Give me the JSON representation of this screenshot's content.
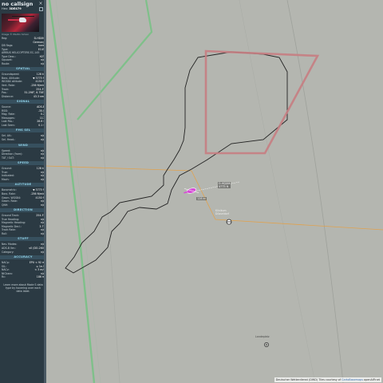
{
  "header": {
    "callsign": "no callsign",
    "hex_label": "Hex:",
    "hex_value": "3DE479",
    "close_glyph": "×"
  },
  "photo": {
    "credit": "Image © Martin Simon"
  },
  "identity": [
    {
      "k": "Reg:",
      "v": "D-HDXM"
    },
    {
      "k": "",
      "v": "Germany"
    },
    {
      "k": "DB flags:",
      "v": "none"
    },
    {
      "k": "Type:",
      "v": "EC45"
    },
    {
      "k": "AIRBUS HELICOPTERS EC-145",
      "v": ""
    },
    {
      "k": "Type Desc.:",
      "v": "H2T"
    },
    {
      "k": "Squawk:",
      "v": "n/a"
    },
    {
      "k": "Route:",
      "v": "n/a"
    }
  ],
  "sections": {
    "spatial": "SPATIAL",
    "signal": "SIGNAL",
    "fms_sel": "FMS SEL",
    "wind": "WIND",
    "speed": "SPEED",
    "altitude": "ALTITUDE",
    "direction": "DIRECTION",
    "stuff": "STUFF",
    "accuracy": "ACCURACY"
  },
  "spatial": [
    {
      "k": "Groundspeed:",
      "v": "128 kt"
    },
    {
      "k": "Baro. Altitude:",
      "v": "▼ 3775 ft"
    },
    {
      "k": "WGS84 altitude:",
      "v": "4150 ft"
    },
    {
      "k": "Vert. Rate:",
      "v": "-256 ft/min"
    },
    {
      "k": "Track:",
      "v": "254.3°"
    },
    {
      "k": "Pos.:",
      "v": "51.298°, 6.758°"
    },
    {
      "k": "Distance:",
      "v": "43.3 nmi"
    }
  ],
  "signal": [
    {
      "k": "Source:",
      "v": "ADS-B"
    },
    {
      "k": "RSSI:",
      "v": "-30.0"
    },
    {
      "k": "Msg. Rate:",
      "v": "0.2"
    },
    {
      "k": "Messages:",
      "v": "117"
    },
    {
      "k": "Last Pos.:",
      "v": "28.6 s"
    },
    {
      "k": "Last Seen:",
      "v": "0.1 s"
    }
  ],
  "fms": [
    {
      "k": "Sel. Alt.:",
      "v": "n/a"
    },
    {
      "k": "Sel. Head.:",
      "v": "n/a"
    }
  ],
  "wind": [
    {
      "k": "Speed:",
      "v": "n/a"
    },
    {
      "k": "Direction (from):",
      "v": "n/a"
    },
    {
      "k": "TAT / OAT:",
      "v": "n/a"
    }
  ],
  "speed": [
    {
      "k": "Ground:",
      "v": "128 kt"
    },
    {
      "k": "True:",
      "v": "n/a"
    },
    {
      "k": "Indicated:",
      "v": "n/a"
    },
    {
      "k": "Mach:",
      "v": "n/a"
    }
  ],
  "altitude": [
    {
      "k": "Barometric:",
      "v": "▼ 3775 ft"
    },
    {
      "k": "Baro. Rate:",
      "v": "-256 ft/min"
    },
    {
      "k": "Geom. WGS84:",
      "v": "4150 ft"
    },
    {
      "k": "Geom. Rate:",
      "v": "n/a"
    },
    {
      "k": "QNH:",
      "v": "n/a"
    }
  ],
  "direction": [
    {
      "k": "Ground Track:",
      "v": "254.3°"
    },
    {
      "k": "True Heading:",
      "v": "n/a"
    },
    {
      "k": "Magnetic Heading:",
      "v": "n/a"
    },
    {
      "k": "Magnetic Decl.:",
      "v": "3.7°"
    },
    {
      "k": "Track Rate:",
      "v": "n/a"
    },
    {
      "k": "Roll:",
      "v": "n/a"
    }
  ],
  "stuff": [
    {
      "k": "Nav. Modes:",
      "v": "n/a"
    },
    {
      "k": "ADS-B Ver.:",
      "v": "v0 (DO-260)"
    },
    {
      "k": "Category:",
      "v": "n/a"
    }
  ],
  "accuracy": [
    {
      "k": "NACp:",
      "v": "EPU < 92 m"
    },
    {
      "k": "SIL:",
      "v": "≤ 1e-5"
    },
    {
      "k": "NACv:",
      "v": "< 3 m/s"
    },
    {
      "k": "NICbaro:",
      "v": "n/a"
    },
    {
      "k": "Rc:",
      "v": "186 m"
    }
  ],
  "footnote": "Learn more about Mode S data type by hovering over each data label.",
  "map": {
    "aircraft_label_line1": "D-HDXM",
    "aircraft_label_line2": "3775 ft",
    "aircraft_label_line3": "128 kt",
    "place_label_1": "Klinikum",
    "place_label_2": "Düsseldorf",
    "airfield_label": "Landeplatz",
    "attribution_text": "Deutscher Wetterdienst (DWD) Tiles courtesy of",
    "attribution_link": "CartoBasemaps",
    "attribution_osm": "openAIP.net"
  },
  "colors": {
    "map_bg": "#b4b6b0",
    "sidebar_bg": "#2b3a43",
    "section_header": "#37505e",
    "airspace_pink": "#c77d82",
    "road_green": "#7fc08a",
    "border_orange": "#e0a24f",
    "aircraft_magenta": "#d64bd6"
  }
}
